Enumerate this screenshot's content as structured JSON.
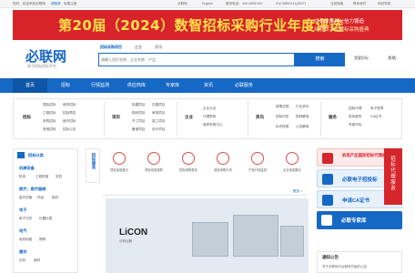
{
  "topbar": {
    "greeting": "您好，欢迎来到必联网",
    "login": "请登录",
    "register": "免费注册",
    "mobile": "必联网",
    "english": "English",
    "phone": "服务电话：400-0808-000",
    "phone2": "010-58851111(8097)",
    "service": "业务指南",
    "contact": "联系我们",
    "nav": "网站导航"
  },
  "banner": {
    "title": "第20届（2024）数智招标采购行业年度评选",
    "line1": "以专业度与公信力锻造",
    "line2": "年度数字化招标采购盛典"
  },
  "logo": {
    "name": "必联网",
    "slogan": "电子招标投标平台"
  },
  "search": {
    "tabs": [
      "招标采购项目",
      "企业",
      "资讯"
    ],
    "placeholder": "请输入项目名称、企业名称、产品",
    "button": "搜索",
    "hot": "我要投标",
    "city": "总站"
  },
  "nav": {
    "items": [
      "首页",
      "招标",
      "行情监测",
      "供应商库",
      "专家库",
      "资讯",
      "必联服务"
    ]
  },
  "cat": {
    "g1": {
      "head": "招标",
      "items": [
        [
          "国际招标",
          "政府招标"
        ],
        [
          "工程招标",
          "招标预告"
        ],
        [
          "采购招标",
          "医疗招标"
        ],
        [
          "其他招标",
          "招标公告"
        ]
      ]
    },
    "g2": {
      "head": "项目",
      "items": [
        [
          "拟建项目",
          "在建项目"
        ],
        [
          "规划项目",
          "审批项目"
        ],
        [
          "开工项目",
          "竣工项目"
        ],
        [
          "备案项目",
          "设计项目"
        ]
      ]
    },
    "g3": {
      "head": "企业",
      "items": [
        [
          "企业大全"
        ],
        [
          "代理机构"
        ],
        [
          "政府采购中心"
        ]
      ]
    },
    "g4": {
      "head": "资讯",
      "items": [
        [
          "政策法规",
          "行业资讯"
        ],
        [
          "招标问答",
          "规则解读"
        ],
        [
          "标讯快报",
          "公告解读"
        ]
      ]
    },
    "g5": {
      "head": "服务",
      "items": [
        [
          "招标代理",
          "电子签章"
        ],
        [
          "投标服务",
          "CA证书"
        ],
        [
          "专家评标"
        ]
      ]
    }
  },
  "side": {
    "title": "招标分类",
    "groups": [
      {
        "head": "机械设备",
        "items": [
          "机床",
          "工程机械",
          "农机"
        ]
      },
      {
        "head": "医疗、医疗器械",
        "items": [
          "医疗设备",
          "药品",
          "耗材"
        ]
      },
      {
        "head": "电子",
        "items": [
          "电子元件",
          "仪器仪表"
        ]
      },
      {
        "head": "电气",
        "items": [
          "电线电缆",
          "照明"
        ]
      },
      {
        "head": "建材",
        "items": [
          "石材",
          "钢材"
        ]
      }
    ]
  },
  "services": {
    "vtitle": "招标服务",
    "items": [
      "项目信息登记",
      "项目动态追踪",
      "招标采购发布",
      "招标采购行情",
      "产品行情监测",
      "企业信息展示"
    ]
  },
  "ad": {
    "title": "LiCON",
    "sub": "分析仪器",
    "more": "更多 >"
  },
  "right": [
    {
      "label": "机电产品国际招标代理机构",
      "color": "#d6252b"
    },
    {
      "label": "必联电子招投标",
      "color": "#1668c5"
    },
    {
      "label": "申请CA证书",
      "color": "#1668c5"
    },
    {
      "label": "必联专家库",
      "color": "#1668c5"
    }
  ],
  "float": {
    "label": "招标代理服务"
  },
  "notice": {
    "title": "通知公告",
    "item": "关于必联网平台服务升级的公告"
  }
}
